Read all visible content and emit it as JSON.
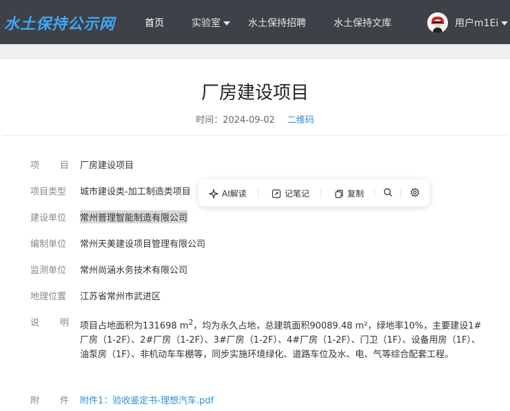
{
  "header": {
    "logo": "水土保持公示网",
    "nav": [
      "首页",
      "实验室",
      "水土保持招聘",
      "水土保持文库"
    ],
    "user": "用户m1Ei"
  },
  "article": {
    "title": "厂房建设项目",
    "time_label": "时间：",
    "time_value": "2024-09-02",
    "qr": "二维码"
  },
  "fields": {
    "project": {
      "label_a": "项",
      "label_b": "目",
      "value": "厂房建设项目"
    },
    "type": {
      "label": "项目类型",
      "value": "城市建设类-加工制造类项目"
    },
    "builder": {
      "label": "建设单位",
      "value": "常州普理智能制造有限公司"
    },
    "compiler": {
      "label": "编制单位",
      "value": "常州天美建设项目管理有限公司"
    },
    "monitor": {
      "label": "监测单位",
      "value": "常州尚涵水务技术有限公司"
    },
    "location": {
      "label": "地理位置",
      "value": "江苏省常州市武进区"
    },
    "desc": {
      "label_a": "说",
      "label_b": "明",
      "part1": "项目占地面积为131698 m",
      "sup": "2",
      "part2": "，均为永久占地，总建筑面积90089.48 m²，绿地率10%，主要建设1#厂房（1-2F）、2#厂房（1-2F）、3#厂房（1-2F）、4#厂房（1-2F）、门卫（1F）、设备用房（1F）、油泵房（1F）、非机动车车棚等，同步实施环境绿化、道路车位及水、电、气等综合配套工程。"
    },
    "attach": {
      "label_a": "附",
      "label_b": "件",
      "value": "附件1：验收鉴定书-理想汽车.pdf"
    }
  },
  "toolbar": {
    "ai": "AI解读",
    "note": "记笔记",
    "copy": "复制"
  },
  "colors": {
    "header_bg": "#3e4147",
    "logo": "#3fa8f5",
    "link": "#2d8fd6"
  }
}
